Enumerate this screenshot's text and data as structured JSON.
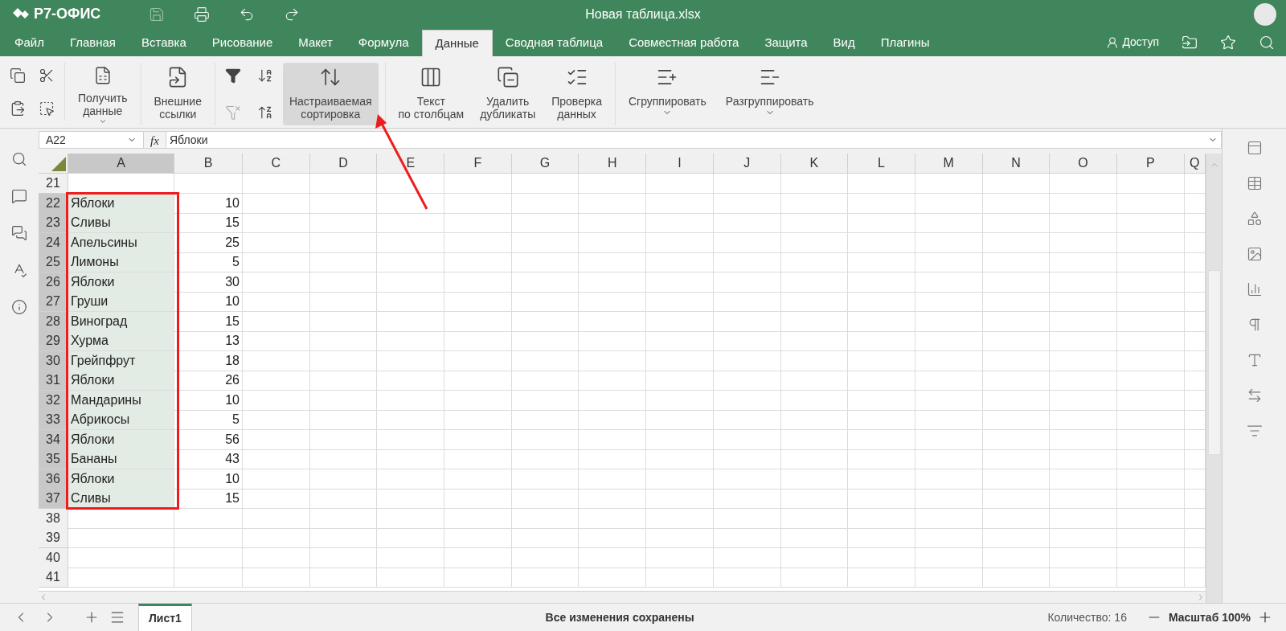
{
  "app": {
    "logo": "Р7-ОФИС",
    "title": "Новая таблица.xlsx"
  },
  "tabs": [
    {
      "label": "Файл",
      "selected": false
    },
    {
      "label": "Главная",
      "selected": false
    },
    {
      "label": "Вставка",
      "selected": false
    },
    {
      "label": "Рисование",
      "selected": false
    },
    {
      "label": "Макет",
      "selected": false
    },
    {
      "label": "Формула",
      "selected": false
    },
    {
      "label": "Данные",
      "selected": true
    },
    {
      "label": "Сводная таблица",
      "selected": false
    },
    {
      "label": "Совместная работа",
      "selected": false
    },
    {
      "label": "Защита",
      "selected": false
    },
    {
      "label": "Вид",
      "selected": false
    },
    {
      "label": "Плагины",
      "selected": false
    }
  ],
  "access_button": "Доступ",
  "toolbar": {
    "get_data": {
      "label": "Получить данные",
      "pressed": false
    },
    "external_links": {
      "label": "Внешние ссылки",
      "pressed": false
    },
    "custom_sort": {
      "label": "Настраиваемая сортировка",
      "pressed": true
    },
    "data_tools": [
      {
        "label": "Текст по столбцам",
        "kind": "split"
      },
      {
        "label": "Удалить дубликаты",
        "kind": "dedupe"
      },
      {
        "label": "Проверка данных",
        "kind": "validate"
      }
    ],
    "grouping": [
      {
        "label": "Сгруппировать",
        "kind": "group"
      },
      {
        "label": "Разгруппировать",
        "kind": "ungroup"
      }
    ]
  },
  "formula_bar": {
    "cell_ref": "A22",
    "fx": "fx",
    "value": "Яблоки"
  },
  "sheet": {
    "columns": [
      {
        "label": "A",
        "selected": true
      },
      {
        "label": "B",
        "selected": false
      },
      {
        "label": "C",
        "selected": false
      },
      {
        "label": "D",
        "selected": false
      },
      {
        "label": "E",
        "selected": false
      },
      {
        "label": "F",
        "selected": false
      },
      {
        "label": "G",
        "selected": false
      },
      {
        "label": "H",
        "selected": false
      },
      {
        "label": "I",
        "selected": false
      },
      {
        "label": "J",
        "selected": false
      },
      {
        "label": "K",
        "selected": false
      },
      {
        "label": "L",
        "selected": false
      },
      {
        "label": "M",
        "selected": false
      },
      {
        "label": "N",
        "selected": false
      },
      {
        "label": "O",
        "selected": false
      },
      {
        "label": "P",
        "selected": false
      },
      {
        "label": "Q",
        "selected": false
      }
    ],
    "rows": [
      {
        "number": "21",
        "selected": false
      },
      {
        "number": "22",
        "a": "Яблоки",
        "b": "10",
        "selected": true
      },
      {
        "number": "23",
        "a": "Сливы",
        "b": "15",
        "selected": true
      },
      {
        "number": "24",
        "a": "Апельсины",
        "b": "25",
        "selected": true
      },
      {
        "number": "25",
        "a": "Лимоны",
        "b": "5",
        "selected": true
      },
      {
        "number": "26",
        "a": "Яблоки",
        "b": "30",
        "selected": true
      },
      {
        "number": "27",
        "a": "Груши",
        "b": "10",
        "selected": true
      },
      {
        "number": "28",
        "a": "Виноград",
        "b": "15",
        "selected": true
      },
      {
        "number": "29",
        "a": "Хурма",
        "b": "13",
        "selected": true
      },
      {
        "number": "30",
        "a": "Грейпфрут",
        "b": "18",
        "selected": true
      },
      {
        "number": "31",
        "a": "Яблоки",
        "b": "26",
        "selected": true
      },
      {
        "number": "32",
        "a": "Мандарины",
        "b": "10",
        "selected": true
      },
      {
        "number": "33",
        "a": "Абрикосы",
        "b": "5",
        "selected": true
      },
      {
        "number": "34",
        "a": "Яблоки",
        "b": "56",
        "selected": true
      },
      {
        "number": "35",
        "a": "Бананы",
        "b": "43",
        "selected": true
      },
      {
        "number": "36",
        "a": "Яблоки",
        "b": "10",
        "selected": true
      },
      {
        "number": "37",
        "a": "Сливы",
        "b": "15",
        "selected": true
      },
      {
        "number": "38",
        "selected": false
      },
      {
        "number": "39",
        "selected": false
      },
      {
        "number": "40",
        "selected": false
      },
      {
        "number": "41",
        "selected": false
      }
    ]
  },
  "sheet_tabs": [
    {
      "label": "Лист1",
      "selected": true
    }
  ],
  "status": {
    "message": "Все изменения сохранены",
    "count": "Количество: 16",
    "zoom": "Масштаб 100%"
  }
}
